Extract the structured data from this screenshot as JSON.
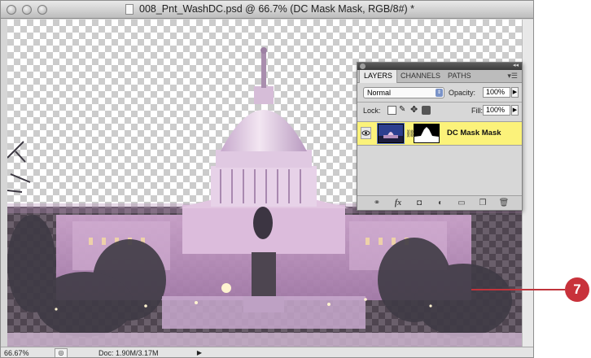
{
  "window": {
    "title": "008_Pnt_WashDC.psd @ 66.7% (DC Mask Mask, RGB/8#) *"
  },
  "status_bar": {
    "zoom": "66.67%",
    "doc_info": "Doc: 1.90M/3.17M"
  },
  "layers_panel": {
    "tabs": [
      {
        "label": "LAYERS",
        "active": true
      },
      {
        "label": "CHANNELS",
        "active": false
      },
      {
        "label": "PATHS",
        "active": false
      }
    ],
    "blend_mode": "Normal",
    "opacity_label": "Opacity:",
    "opacity_value": "100%",
    "lock_label": "Lock:",
    "fill_label": "Fill:",
    "fill_value": "100%",
    "layers": [
      {
        "name": "DC Mask Mask",
        "selected": true,
        "visible": true
      }
    ],
    "bottom_icons": [
      "link-layers-icon",
      "fx-icon",
      "add-mask-icon",
      "adjustment-layer-icon",
      "new-group-icon",
      "new-layer-icon",
      "trash-icon"
    ],
    "selection_color": "#fbf27a"
  },
  "callout": {
    "number": "7",
    "color": "#c8323b"
  }
}
